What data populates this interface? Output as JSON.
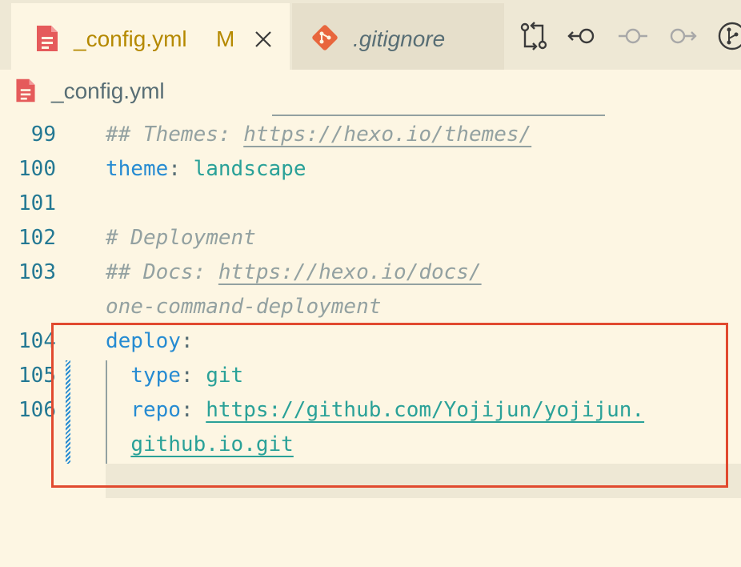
{
  "tabs": [
    {
      "label": "_config.yml",
      "badge": "M",
      "active": true,
      "icon": "yaml-file-icon"
    },
    {
      "label": ".gitignore",
      "active": false,
      "icon": "git-icon"
    }
  ],
  "toolbar": {
    "icons": [
      "compare-changes-icon",
      "go-to-previous-change-icon",
      "git-commit-icon",
      "go-to-next-change-icon",
      "git-branch-icon"
    ]
  },
  "breadcrumb": {
    "file": "_config.yml"
  },
  "editor": {
    "lines": [
      {
        "number": "99",
        "parts": [
          {
            "text": "## Themes: ",
            "cls": "cmt"
          },
          {
            "text": "https://hexo.io/themes/",
            "cls": "cmt link"
          }
        ]
      },
      {
        "number": "100",
        "parts": [
          {
            "text": "theme",
            "cls": "key"
          },
          {
            "text": ": ",
            "cls": "punc"
          },
          {
            "text": "landscape",
            "cls": "val"
          }
        ]
      },
      {
        "number": "101",
        "parts": []
      },
      {
        "number": "102",
        "parts": [
          {
            "text": "# Deployment",
            "cls": "cmt"
          }
        ]
      },
      {
        "number": "103",
        "parts": [
          {
            "text": "## Docs: ",
            "cls": "cmt"
          },
          {
            "text": "https://hexo.io/docs/",
            "cls": "cmt link"
          }
        ]
      },
      {
        "number": "",
        "parts": [
          {
            "text": "one-command-deployment",
            "cls": "cmt"
          }
        ]
      },
      {
        "number": "104",
        "parts": [
          {
            "text": "deploy",
            "cls": "key"
          },
          {
            "text": ":",
            "cls": "punc"
          }
        ]
      },
      {
        "number": "105",
        "parts": [
          {
            "text": "  type",
            "cls": "key"
          },
          {
            "text": ": ",
            "cls": "punc"
          },
          {
            "text": "git",
            "cls": "val"
          }
        ]
      },
      {
        "number": "106",
        "parts": [
          {
            "text": "  repo",
            "cls": "key"
          },
          {
            "text": ": ",
            "cls": "punc"
          },
          {
            "text": "https://github.com/Yojijun/yojijun.",
            "cls": "val link"
          }
        ]
      },
      {
        "number": "",
        "parts": [
          {
            "text": "  ",
            "cls": "punc"
          },
          {
            "text": "github.io.git",
            "cls": "val link"
          }
        ]
      }
    ]
  },
  "colors": {
    "highlight_border": "#e14a2f",
    "tab_label": "#b58900",
    "modified_badge": "#b58900"
  }
}
